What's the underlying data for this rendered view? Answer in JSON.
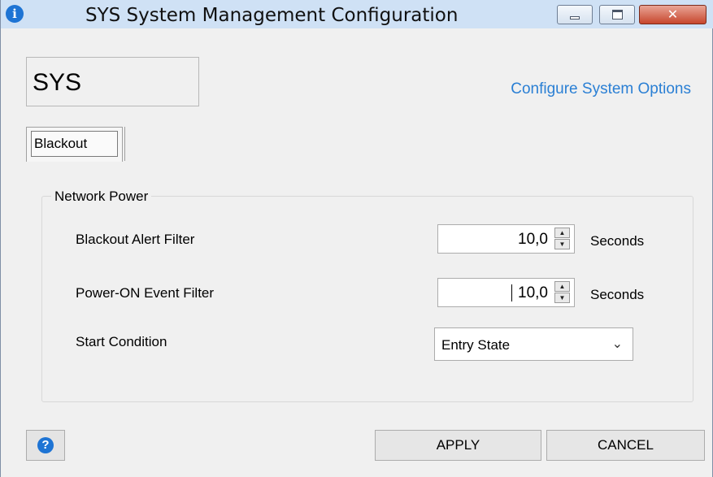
{
  "window": {
    "title": "SYS System Management Configuration",
    "icon": "info-icon",
    "close_glyph": "✕"
  },
  "header": {
    "module_label": "SYS",
    "configure_link": "Configure System Options"
  },
  "tabs": [
    {
      "label": "Blackout",
      "selected": true
    }
  ],
  "group": {
    "title": "Network Power",
    "rows": [
      {
        "label": "Blackout Alert Filter",
        "value": "10,0",
        "unit": "Seconds"
      },
      {
        "label": "Power-ON Event Filter",
        "value": "10,0",
        "unit": "Seconds"
      },
      {
        "label": "Start Condition",
        "selected_option": "Entry State"
      }
    ]
  },
  "footer": {
    "help_glyph": "?",
    "apply_label": "APPLY",
    "cancel_label": "CANCEL"
  },
  "colors": {
    "titlebar": "#cfe1f5",
    "link": "#2a7fd4",
    "close_button": "#c7462d",
    "icon_blue": "#1e74d4"
  }
}
